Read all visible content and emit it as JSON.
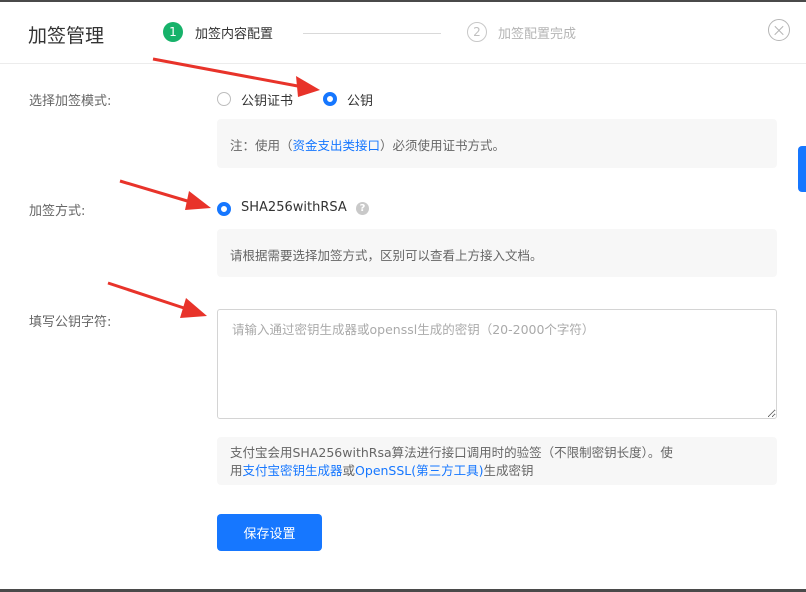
{
  "header": {
    "title": "加签管理",
    "steps": [
      {
        "number": "1",
        "label": "加签内容配置",
        "state": "active"
      },
      {
        "number": "2",
        "label": "加签配置完成",
        "state": "pending"
      }
    ],
    "close_icon": "close-circle-icon"
  },
  "sign_mode": {
    "label": "选择加签模式:",
    "options": [
      {
        "label": "公钥证书",
        "selected": false
      },
      {
        "label": "公钥",
        "selected": true
      }
    ],
    "note_prefix": "注：使用（",
    "note_link": "资金支出类接口",
    "note_suffix": "）必须使用证书方式。"
  },
  "sign_method": {
    "label": "加签方式:",
    "option": "SHA256withRSA",
    "option_selected": true,
    "help_icon": "question-circle-icon",
    "note": "请根据需要选择加签方式，区别可以查看上方接入文档。"
  },
  "public_key": {
    "label": "填写公钥字符:",
    "value": "",
    "placeholder": "请输入通过密钥生成器或openssl生成的密钥（20-2000个字符）"
  },
  "info_box": {
    "line1": "支付宝会用SHA256withRsa算法进行接口调用时的验签（不限制密钥长度）。使",
    "line2_prefix": "用",
    "link1": "支付宝密钥生成器",
    "mid": "或",
    "link2": "OpenSSL(第三方工具)",
    "line2_suffix": "生成密钥"
  },
  "save_button": "保存设置",
  "colors": {
    "primary": "#1677ff",
    "step_active": "#17b26a",
    "annotation_arrow": "#e8332a"
  }
}
